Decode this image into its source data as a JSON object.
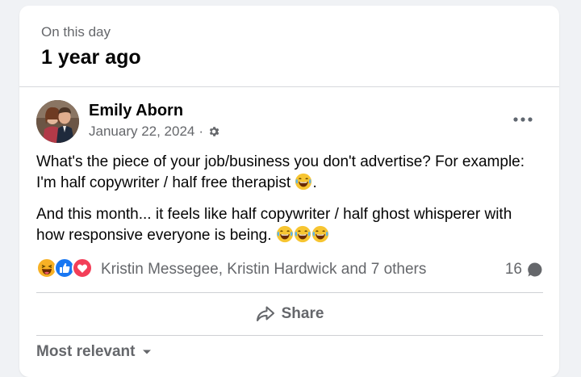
{
  "memory": {
    "eyebrow": "On this day",
    "headline": "1 year ago"
  },
  "post": {
    "author": "Emily Aborn",
    "date": "January 22, 2024",
    "separator": "·",
    "audience_icon": "gear-icon",
    "more_icon": "more-options-icon",
    "paragraph1": "What's the piece of your job/business you don't advertise? For example: I'm half copywriter / half free therapist",
    "paragraph1_end": ".",
    "paragraph2": "And this month... it feels like half copywriter / half ghost whisperer with how responsive everyone is being.",
    "emoji": "laughing-crying-emoji"
  },
  "reactions": {
    "types": [
      "haha",
      "like",
      "love"
    ],
    "names": "Kristin Messegee, Kristin Hardwick and 7 others",
    "comment_count": "16"
  },
  "actions": {
    "share_label": "Share"
  },
  "comments": {
    "sort_label": "Most relevant"
  },
  "colors": {
    "like_blue": "#1877f2",
    "love_red": "#f33e58",
    "haha_yellow": "#f7b125",
    "secondary_text": "#65676b"
  }
}
